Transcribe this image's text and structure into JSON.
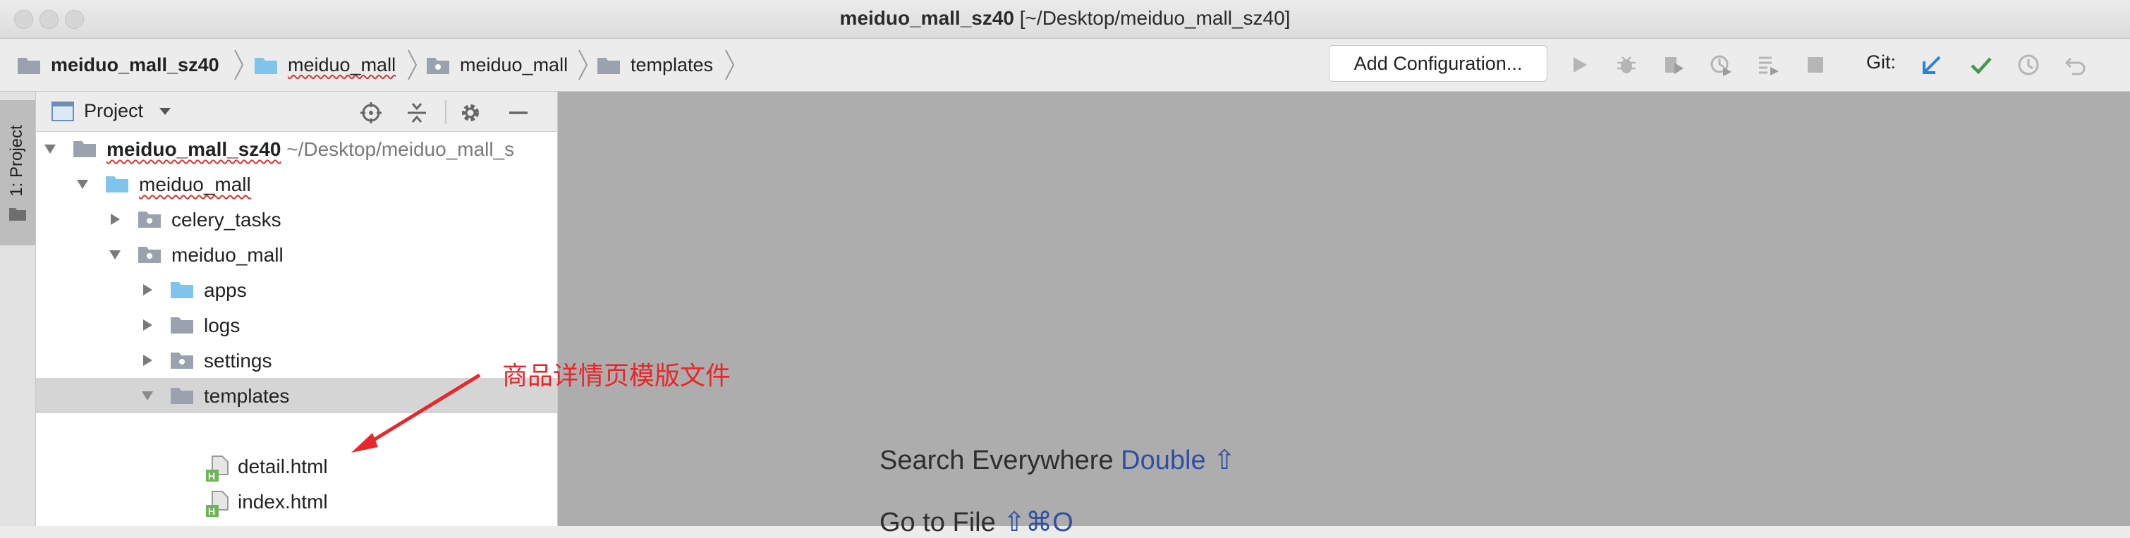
{
  "window": {
    "title_bold": "meiduo_mall_sz40",
    "title_path": " [~/Desktop/meiduo_mall_sz40]"
  },
  "breadcrumb": [
    {
      "label": "meiduo_mall_sz40",
      "icon": "folder-icon"
    },
    {
      "label": "meiduo_mall",
      "icon": "folder-blue-icon"
    },
    {
      "label": "meiduo_mall",
      "icon": "package-folder-icon"
    },
    {
      "label": "templates",
      "icon": "folder-icon"
    }
  ],
  "toolbar": {
    "add_configuration": "Add Configuration...",
    "git_label": "Git:",
    "icons": [
      "run-icon",
      "debug-icon",
      "coverage-icon",
      "profile-icon",
      "concurrency-icon",
      "stop-icon",
      "git-update-icon",
      "git-commit-icon",
      "git-history-icon",
      "git-revert-icon"
    ]
  },
  "sidebar": {
    "tab_label": "1: Project"
  },
  "project_panel": {
    "title": "Project",
    "tree": [
      {
        "label": "meiduo_mall_sz40",
        "extra": " ~/Desktop/meiduo_mall_s",
        "expanded": true
      },
      {
        "label": "meiduo_mall",
        "expanded": true
      },
      {
        "label": "celery_tasks",
        "expanded": false
      },
      {
        "label": "meiduo_mall",
        "expanded": true
      },
      {
        "label": "apps",
        "expanded": false
      },
      {
        "label": "logs",
        "expanded": false
      },
      {
        "label": "settings",
        "expanded": false
      },
      {
        "label": "templates",
        "expanded": true,
        "selected": true
      },
      {
        "label": "detail.html"
      },
      {
        "label": "index.html"
      }
    ]
  },
  "editor": {
    "search_everywhere": "Search Everywhere",
    "search_shortcut": "Double ⇧",
    "goto_file": "Go to File",
    "goto_shortcut": "⇧⌘O"
  },
  "annotation": {
    "text": "商品详情页模版文件",
    "color": "#e8262b"
  },
  "colors": {
    "folder_gray": "#9aa3ad",
    "folder_blue": "#7fc4ea",
    "editor_bg": "#adadad",
    "selection": "#d5d5d5",
    "git_accent_blue": "#2e82d6",
    "git_accent_green": "#3c9b48"
  }
}
